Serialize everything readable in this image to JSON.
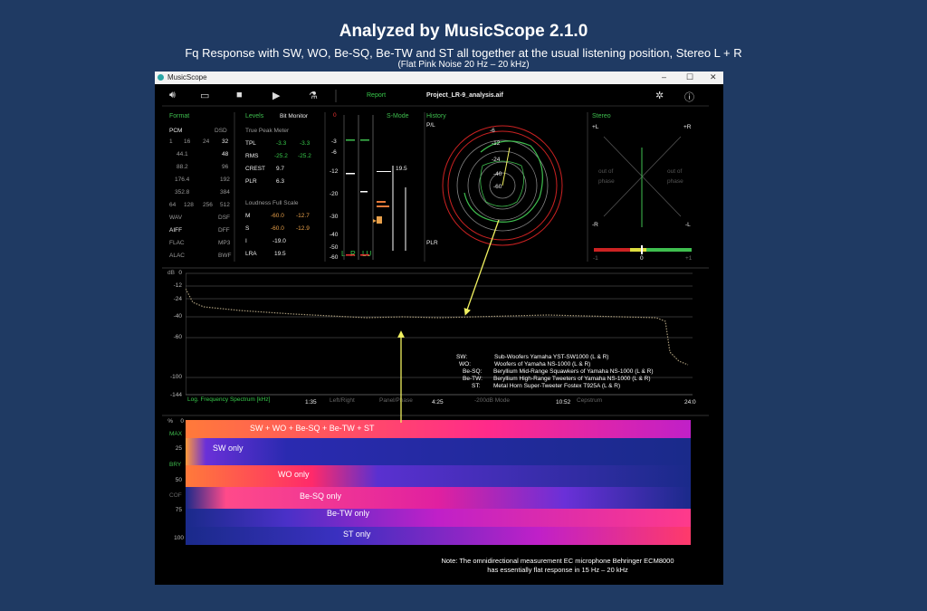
{
  "heading": {
    "title": "Analyzed by MusicScope 2.1.0",
    "subtitle": "Fq Response with SW, WO, Be-SQ, Be-TW and ST all together at the usual listening position, Stereo L + R",
    "subtitle2": "(Flat Pink Noise 20 Hz – 20 kHz)"
  },
  "window": {
    "app_name": "MusicScope",
    "minimize": "–",
    "maximize": "☐",
    "close": "✕"
  },
  "toolbar": {
    "report_label": "Report",
    "project_name": "Project_LR-9_analysis.aif"
  },
  "format": {
    "title": "Format",
    "pcm": "PCM",
    "dsd": "DSD",
    "bits": [
      "1",
      "16",
      "24",
      "32"
    ],
    "rates": [
      [
        "44.1",
        "48"
      ],
      [
        "88.2",
        "96"
      ],
      [
        "176.4",
        "192"
      ],
      [
        "352.8",
        "384"
      ]
    ],
    "dsd_rates": [
      "64",
      "128",
      "256",
      "512"
    ],
    "files": [
      [
        "WAV",
        "DSF"
      ],
      [
        "AIFF",
        "DFF"
      ],
      [
        "FLAC",
        "MP3"
      ],
      [
        "ALAC",
        "BWF"
      ]
    ]
  },
  "levels": {
    "title": "Levels",
    "bit_monitor": "Bit Monitor",
    "true_peak_title": "True Peak Meter",
    "rows": [
      {
        "label": "TPL",
        "l": "-3.3",
        "r": "-3.3"
      },
      {
        "label": "RMS",
        "l": "-25.2",
        "r": "-25.2"
      },
      {
        "label": "CREST",
        "l": "9.7",
        "r": ""
      },
      {
        "label": "PLR",
        "l": "6.3",
        "r": ""
      }
    ],
    "loudness_title": "Loudness Full Scale",
    "loud_rows": [
      {
        "label": "M",
        "v1": "-60.0",
        "v2": "-12.7"
      },
      {
        "label": "S",
        "v1": "-60.0",
        "v2": "-12.9"
      },
      {
        "label": "I",
        "v1": "-19.0",
        "v2": ""
      },
      {
        "label": "LRA",
        "v1": "19.5",
        "v2": ""
      }
    ]
  },
  "meter": {
    "smode": "S-Mode",
    "scale": [
      "0",
      "-3",
      "-6",
      "-12",
      "-20",
      "-30",
      "-40",
      "-50",
      "-60"
    ],
    "value": "19.5",
    "l": "L",
    "r": "R",
    "lu": "LU"
  },
  "history": {
    "title": "History",
    "pl": "P/L",
    "plr": "PLR",
    "rings": [
      "-6",
      "-12",
      "-24",
      "-40",
      "-60"
    ]
  },
  "stereo": {
    "title": "Stereo",
    "pl": "+L",
    "pr": "+R",
    "ml": "-R",
    "mr": "-L",
    "oop": "out of",
    "phase": "phase",
    "scale": [
      "-1",
      "0",
      "+1"
    ]
  },
  "spectrum": {
    "db_label": "dB",
    "yticks": [
      "0",
      "-12",
      "-24",
      "-40",
      "-60",
      "-100",
      "-144"
    ],
    "xlabel": "Log. Frequency Spectrum [kHz]",
    "xticks": [
      "1:35",
      "4:25",
      "10:52",
      "24:0"
    ],
    "modes": [
      "Left/Right",
      "Panel/Phase",
      "-200dB Mode",
      "Cepstrum"
    ]
  },
  "legend": [
    {
      "key": "SW:",
      "desc": "Sub-Woofers Yamaha YST-SW1000 (L & R)"
    },
    {
      "key": "WO:",
      "desc": "Woofers of Yamaha NS-1000 (L & R)"
    },
    {
      "key": "Be-SQ:",
      "desc": "Beryllium Mid-Range Squawkers of Yamaha NS-1000 (L & R)"
    },
    {
      "key": "Be-TW:",
      "desc": "Beryllium High-Range Tweeters of Yamaha NS-1000 (L & R)"
    },
    {
      "key": "ST:",
      "desc": "Metal Horn Super-Tweeter Fostex T925A (L & R)"
    }
  ],
  "spectrogram": {
    "ylabels": [
      "%",
      "0",
      "MAX",
      "25",
      "BRY",
      "50",
      "COF",
      "75",
      "100"
    ],
    "bands": [
      "SW + WO + Be-SQ + Be-TW + ST",
      "SW only",
      "WO only",
      "Be-SQ only",
      "Be-TW only",
      "ST only"
    ]
  },
  "note": {
    "line1": "Note: The omnidirectional measurement EC microphone Behringer ECM8000",
    "line2": "has essentially flat response in 15 Hz – 20 kHz"
  },
  "colors": {
    "background": "#1f3a63",
    "accent_green": "#3fbf4f",
    "arrow_yellow": "#f0f060"
  }
}
